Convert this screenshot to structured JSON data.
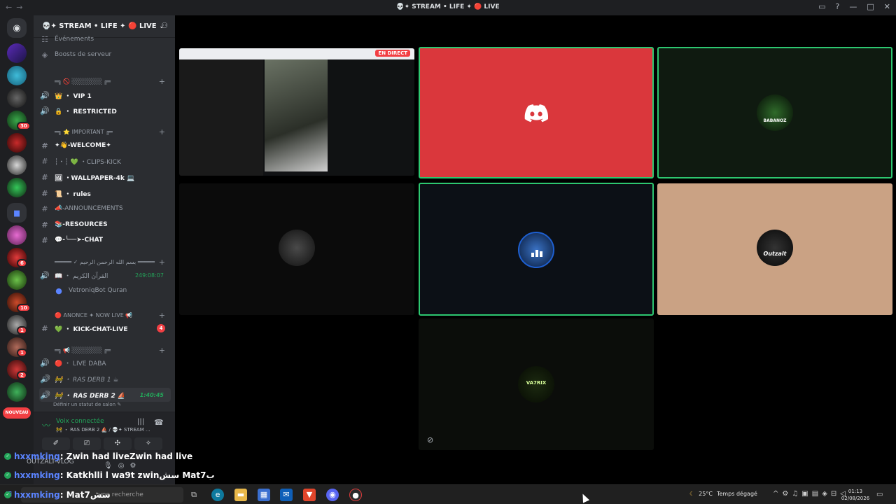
{
  "titlebar": {
    "title": "💀✦ STREAM • LIFE ✦ 🔴 LIVE"
  },
  "guilds": {
    "nouveau_label": "NOUVEAU",
    "badges": [
      "30",
      "6",
      "10",
      "1",
      "1",
      "2",
      "4"
    ]
  },
  "sidebar": {
    "server_name": "💀✦ STREAM • LIFE ✦ 🔴 LIVE",
    "rows": [
      {
        "icon": "☷",
        "label": "Événements",
        "type": "nav"
      },
      {
        "icon": "◈",
        "label": "Boosts de serveur",
        "type": "nav"
      },
      {
        "icon": "",
        "label": "═╗ 🚫 ░░░░░░░ ╔═",
        "type": "cat"
      },
      {
        "icon": "🔊",
        "label": "👑 ・ VIP 1",
        "type": "voice"
      },
      {
        "icon": "🔊",
        "label": "🔒 ・ RESTRICTED",
        "type": "voice"
      },
      {
        "icon": "",
        "label": "═╗ ⭐ IMPORTANT ╔═",
        "type": "cat"
      },
      {
        "icon": "#",
        "label": "✦👋-WELCOME✦",
        "type": "text",
        "bold": true
      },
      {
        "icon": "#",
        "label": "┆・┆ 💚 ・CLIPS-KICK",
        "type": "text"
      },
      {
        "icon": "#",
        "label": "🖼 ・WALLPAPER-4k 💻",
        "type": "text",
        "bold": true
      },
      {
        "icon": "#",
        "label": "📜 ・ rules",
        "type": "text",
        "bold": true
      },
      {
        "icon": "#",
        "label": "📣-ANNOUNCEMENTS",
        "type": "text"
      },
      {
        "icon": "#",
        "label": "📚-RESOURCES",
        "type": "text",
        "bold": true
      },
      {
        "icon": "#",
        "label": "💬-╰──➤-CHAT",
        "type": "text",
        "bold": true
      },
      {
        "icon": "",
        "label": "═════ ✓ بسم الله الرحمن الرحيم ═════",
        "type": "cat"
      },
      {
        "icon": "🔊",
        "label": "📖 ・ القرآن الكريم",
        "type": "voice",
        "time": "249:08:07"
      },
      {
        "icon": "",
        "label": "VetroniqBot Quran",
        "type": "member"
      },
      {
        "icon": "",
        "label": "🔴 ANONCE ✦ NOW LIVE 📢",
        "type": "cat"
      },
      {
        "icon": "#",
        "label": "💚 ・ KICK-CHAT-LIVE",
        "type": "text",
        "bold": true,
        "mention": "4"
      },
      {
        "icon": "",
        "label": "═╗ 📢 ░░░░░░░ ╔═",
        "type": "cat"
      },
      {
        "icon": "🔊",
        "label": "🔴 ・ LIVE DABA",
        "type": "voice"
      },
      {
        "icon": "🔊",
        "label": "🚧 ・ RAS DERB 1 ☕",
        "type": "voice"
      },
      {
        "icon": "🔊",
        "label": "🚧 ・ RAS DERB 2 ⛵",
        "type": "voice",
        "bold": true,
        "time": "1:40:45"
      },
      {
        "icon": "",
        "label": "Définir un statut de salon ✎",
        "type": "sub"
      }
    ],
    "voice_panel": {
      "status": "Voix connectée",
      "channel": "🚧 ・ RAS DERB 2 ⛵ / 💀✦ STREAM ...",
      "buttons": [
        "✐",
        "⎚",
        "✣",
        "✧"
      ]
    },
    "user_panel": {
      "name": "OUTZALT-VLOG"
    }
  },
  "stage": {
    "live_badge": "EN DIRECT",
    "tiles": [
      {
        "id": "screenshare",
        "bg": "#111214",
        "selected": false
      },
      {
        "id": "discord-logo",
        "bg": "#da373c",
        "selected": true
      },
      {
        "id": "babanoz",
        "bg": "#0f1a10",
        "selected": true,
        "avatar_text": "BABANOZ"
      },
      {
        "id": "hat-man",
        "bg": "#0b0b0b",
        "selected": false
      },
      {
        "id": "stats",
        "bg": "#0c1016",
        "selected": true
      },
      {
        "id": "outzalt",
        "bg": "#caa284",
        "selected": false,
        "avatar_text": "Outzalt"
      },
      {
        "id": "va7rix",
        "bg": "#0b0d0a",
        "selected": false,
        "avatar_text": "VA7RIX"
      }
    ]
  },
  "chat_overlay": {
    "lines": [
      {
        "user": "hxxmking",
        "message": ": Zwin had liveZwin had live"
      },
      {
        "user": "hxxmking",
        "message": ": Katkhlli l wa9t zwinسش Mat7ب"
      },
      {
        "user": "hxxmking",
        "message": ": Mat7سش"
      }
    ]
  },
  "taskbar": {
    "search_placeholder": "une recherche",
    "weather_temp": "25°C",
    "weather_desc": "Temps dégagé",
    "time": "01:13",
    "date": "02/08/2026"
  },
  "colors": {
    "accent_green": "#23a55a",
    "discord_red": "#da373c",
    "sidebar_bg": "#2b2d31"
  }
}
